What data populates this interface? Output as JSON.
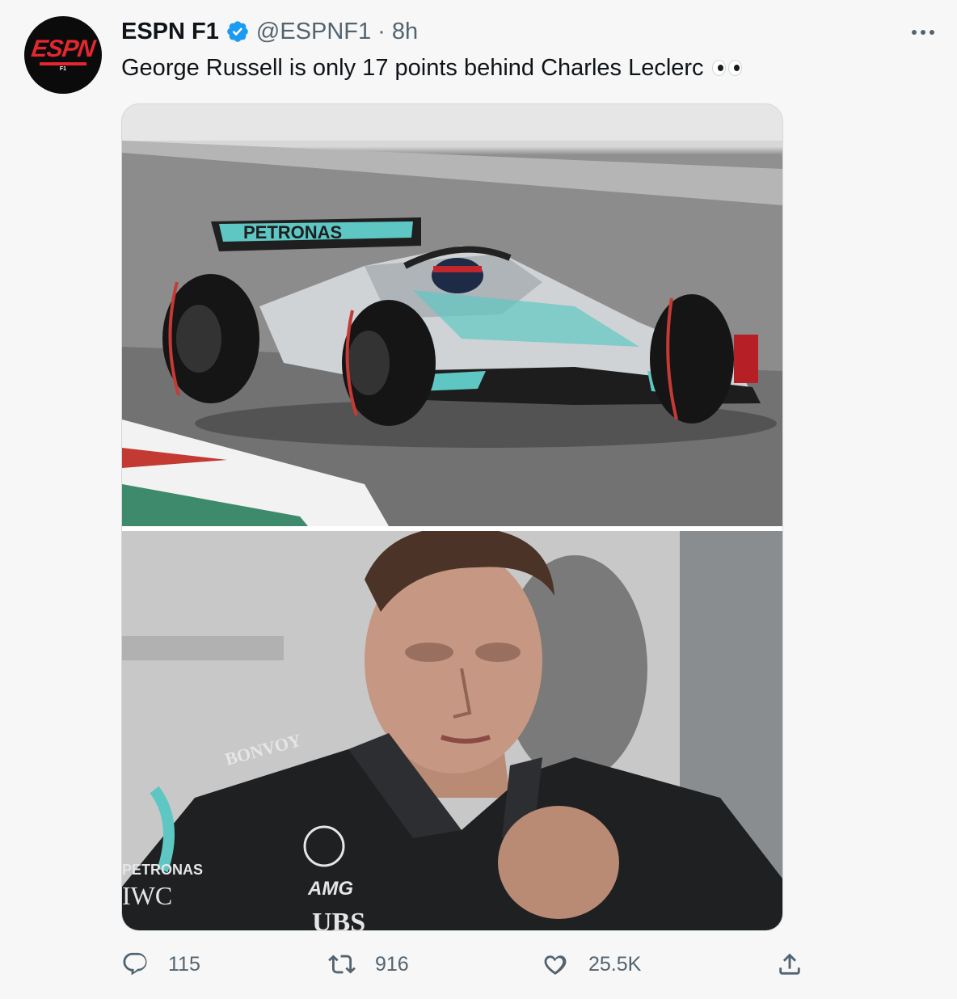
{
  "author": {
    "name": "ESPN F1",
    "handle": "@ESPNF1",
    "separator": "·",
    "time": "8h",
    "avatar_logo": "ESPN",
    "avatar_logo_sub": "F1",
    "verified_icon": "verified-badge-icon"
  },
  "tweet": {
    "text": "George Russell is only 17 points behind Charles Leclerc",
    "emoji": "eyes-emoji"
  },
  "media": {
    "top_car_wing_text": "PETRONAS",
    "bottom_suit_text_left": "PETRONAS",
    "bottom_suit_iwc": "IWC",
    "bottom_suit_ubs": "UBS",
    "bottom_suit_amg": "AMG",
    "bottom_suit_bonvoy": "BONVOY"
  },
  "actions": {
    "reply_count": "115",
    "retweet_count": "916",
    "like_count": "25.5K"
  },
  "colors": {
    "background": "#f7f7f7",
    "verified_blue": "#1d9bf0",
    "secondary_text": "#536471",
    "espn_red": "#e2272e"
  }
}
